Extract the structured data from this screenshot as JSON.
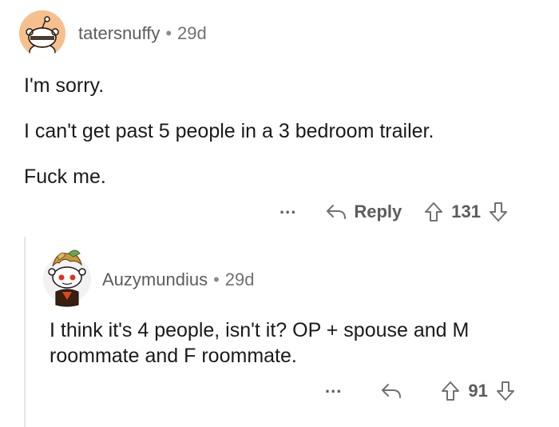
{
  "comment": {
    "username": "tatersnuffy",
    "separator": "•",
    "age": "29d",
    "lines": [
      "I'm sorry.",
      "I can't get past 5 people in a 3 bedroom trailer.",
      "Fuck me."
    ],
    "more_label": "...",
    "reply_label": "Reply",
    "score": "131",
    "avatar_color": "#f6c08e"
  },
  "reply": {
    "username": "Auzymundius",
    "separator": "•",
    "age": "29d",
    "lines": [
      "I think it's 4 people, isn't it? OP + spouse and M",
      "roommate and F roommate."
    ],
    "more_label": "...",
    "score": "91"
  },
  "colors": {
    "meta_text": "#6f7173",
    "thread_line": "#e6e6e6"
  }
}
